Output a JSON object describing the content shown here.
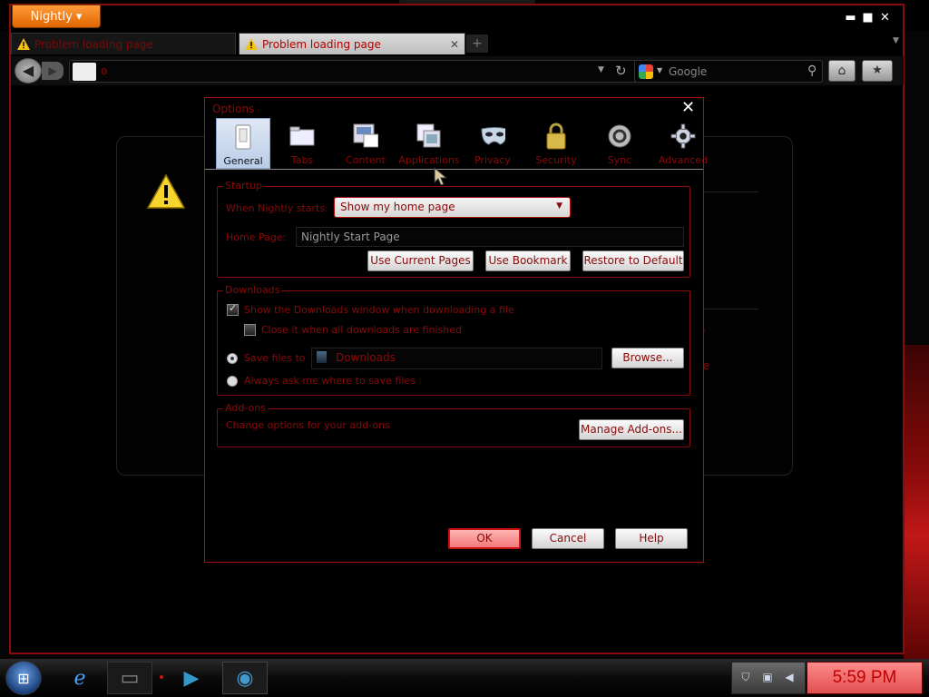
{
  "app_button": {
    "label": "Nightly",
    "arrow": "▾"
  },
  "window_controls": {
    "minimize": "▬",
    "maximize": "■",
    "close": "✕"
  },
  "tabs": [
    {
      "title": "Problem loading page",
      "icon": "warning-icon"
    },
    {
      "title": "Problem loading page",
      "icon": "warning-icon",
      "close": "✕"
    }
  ],
  "newtab_label": "+",
  "tab_list_arrow": "▼",
  "navbar": {
    "back": "◀",
    "forward": "▶",
    "url": "o",
    "url_dropdown": "▼",
    "reload": "↻",
    "search_dropdown": "▼",
    "search_placeholder": "Google",
    "search_button": "⚲",
    "home": "⌂",
    "bookmarks": "★"
  },
  "error_page": {
    "frag1": "e",
    "frag2": "re"
  },
  "dialog": {
    "title": "Options",
    "close": "✕",
    "panes": [
      {
        "label": "General",
        "icon": "general-icon",
        "selected": true
      },
      {
        "label": "Tabs",
        "icon": "tabs-icon"
      },
      {
        "label": "Content",
        "icon": "content-icon"
      },
      {
        "label": "Applications",
        "icon": "applications-icon"
      },
      {
        "label": "Privacy",
        "icon": "privacy-mask-icon"
      },
      {
        "label": "Security",
        "icon": "security-lock-icon"
      },
      {
        "label": "Sync",
        "icon": "sync-icon"
      },
      {
        "label": "Advanced",
        "icon": "advanced-gear-icon"
      }
    ],
    "startup": {
      "group_label": "Startup",
      "when_starts_label": "When Nightly starts:",
      "when_starts_value": "Show my home page",
      "home_page_label": "Home Page:",
      "home_page_value": "Nightly Start Page",
      "use_current_pages": "Use Current Pages",
      "use_bookmark": "Use Bookmark",
      "restore_default": "Restore to Default"
    },
    "downloads": {
      "group_label": "Downloads",
      "show_window_label": "Show the Downloads window when downloading a file",
      "close_when_done_label": "Close it when all downloads are finished",
      "save_files_label": "Save files to",
      "save_folder": "Downloads",
      "browse": "Browse...",
      "always_ask_label": "Always ask me where to save files"
    },
    "addons": {
      "group_label": "Add-ons",
      "description": "Change options for your add-ons",
      "manage": "Manage Add-ons..."
    },
    "ok": "OK",
    "cancel": "Cancel",
    "help": "Help"
  },
  "taskbar": {
    "start": "⊞",
    "clock": "5:59 PM",
    "tray_icons": [
      "shield-icon",
      "network-icon",
      "volume-icon"
    ]
  }
}
